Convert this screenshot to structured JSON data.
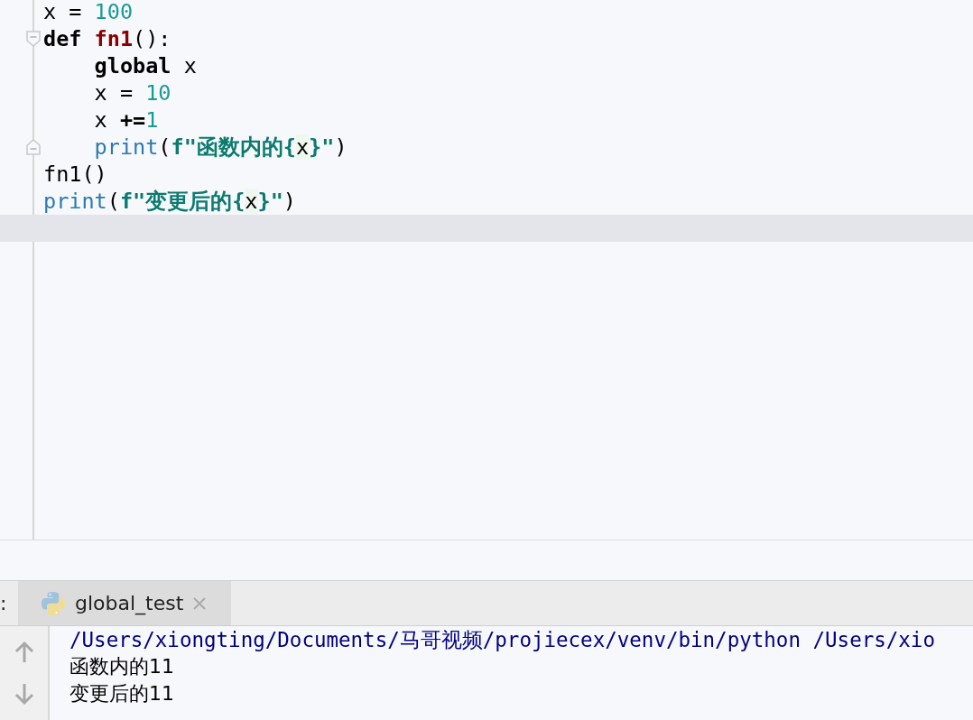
{
  "editor": {
    "lines": [
      {
        "current": false,
        "tokens": [
          {
            "kind": "plain",
            "text": "x = "
          },
          {
            "kind": "number",
            "text": "100"
          }
        ]
      },
      {
        "current": false,
        "fold_marker": {
          "kind": "start"
        },
        "tokens": [
          {
            "kind": "keyword",
            "text": "def "
          },
          {
            "kind": "funcname",
            "text": "fn1"
          },
          {
            "kind": "plain",
            "text": "():"
          }
        ]
      },
      {
        "current": false,
        "tokens": [
          {
            "kind": "keyword",
            "text": "    global "
          },
          {
            "kind": "plain",
            "text": "x"
          }
        ]
      },
      {
        "current": false,
        "tokens": [
          {
            "kind": "plain",
            "text": "    x = "
          },
          {
            "kind": "number",
            "text": "10"
          }
        ]
      },
      {
        "current": false,
        "tokens": [
          {
            "kind": "plain",
            "text": "    x "
          },
          {
            "kind": "keyword",
            "text": "+="
          },
          {
            "kind": "number",
            "text": "1"
          }
        ]
      },
      {
        "current": false,
        "fold_marker": {
          "kind": "end"
        },
        "tokens": [
          {
            "kind": "builtin",
            "text": "    print"
          },
          {
            "kind": "plain",
            "text": "("
          },
          {
            "kind": "string",
            "text": "f\"函数内的{"
          },
          {
            "kind": "variable",
            "text": "x"
          },
          {
            "kind": "string",
            "text": "}\""
          },
          {
            "kind": "plain",
            "text": ")"
          }
        ]
      },
      {
        "current": false,
        "tokens": [
          {
            "kind": "plain",
            "text": "fn1()"
          }
        ]
      },
      {
        "current": false,
        "tokens": [
          {
            "kind": "builtin",
            "text": "print"
          },
          {
            "kind": "plain",
            "text": "("
          },
          {
            "kind": "string",
            "text": "f\"变更后的{"
          },
          {
            "kind": "variable",
            "text": "x"
          },
          {
            "kind": "string",
            "text": "}\""
          },
          {
            "kind": "plain",
            "text": ")"
          }
        ]
      },
      {
        "current": true
      }
    ]
  },
  "run_panel": {
    "label": ":",
    "tabs": [
      {
        "label": "global_test",
        "selected": true
      }
    ],
    "output": [
      {
        "kind": "command",
        "text": "/Users/xiongting/Documents/马哥视频/projiecex/venv/bin/python /Users/xio"
      },
      {
        "kind": "stdout",
        "text": "函数内的11"
      },
      {
        "kind": "stdout",
        "text": "变更后的11"
      }
    ]
  }
}
